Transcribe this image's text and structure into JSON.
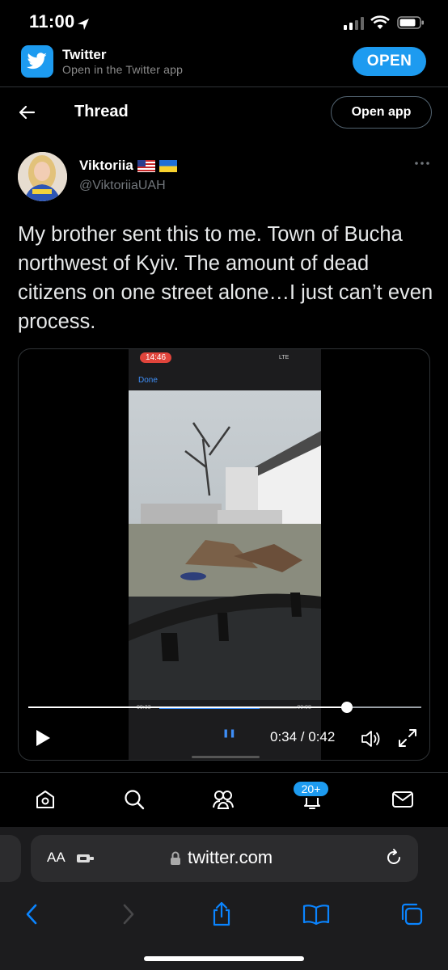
{
  "status_bar": {
    "time": "11:00"
  },
  "app_banner": {
    "title": "Twitter",
    "subtitle": "Open in the Twitter app",
    "open_label": "OPEN"
  },
  "header": {
    "title": "Thread",
    "open_app_label": "Open app"
  },
  "tweet": {
    "display_name": "Viktoriia",
    "flags": [
      "us-flag",
      "ukraine-flag"
    ],
    "handle": "@ViktoriiaUAH",
    "text": "My brother sent this to me. Town of Bucha northwest of Kyiv. The amount of dead citizens on one street alone…I just can’t even process."
  },
  "video": {
    "recorded_screen": {
      "status_time": "14:46",
      "network": "LTE",
      "done_label": "Done",
      "elapsed": "00:33",
      "remaining": "-00:08"
    },
    "progress_fraction": 0.81,
    "time_label": "0:34 / 0:42"
  },
  "bottom_nav": {
    "items": [
      "home-icon",
      "search-icon",
      "communities-icon",
      "notifications-icon",
      "messages-icon"
    ],
    "notification_badge": "20+"
  },
  "safari": {
    "text_size_label": "AA",
    "url": "twitter.com"
  },
  "colors": {
    "accent": "#1d9bf0",
    "background": "#000000",
    "safari_bar": "#1c1c1e",
    "safari_blue": "#0a84ff"
  }
}
